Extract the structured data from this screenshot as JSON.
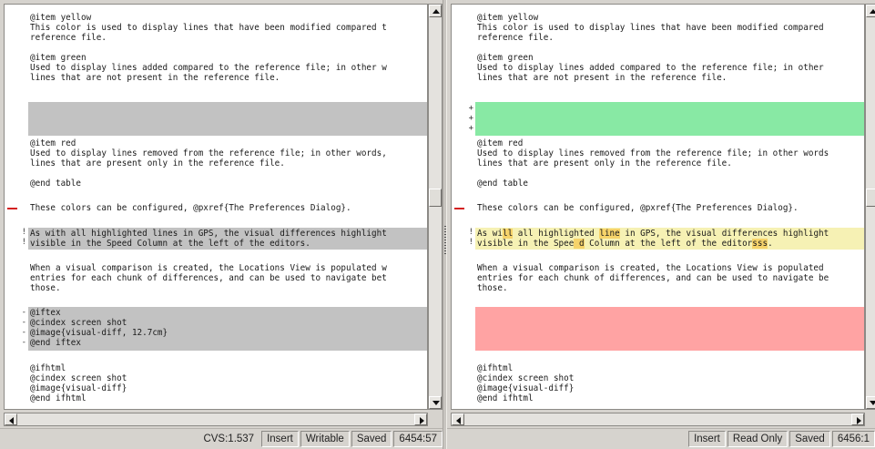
{
  "colors": {
    "removed_gray": "#c2c2c2",
    "added_green": "#88e9a4",
    "removed_red": "#ffa3a3",
    "changed_yellow": "#f6f1b4",
    "changed_word": "#f6d36a",
    "marker_red": "#d42020"
  },
  "left_editor": {
    "lines": {
      "l1": "@item yellow",
      "l2": "This color is used to display lines that have been modified compared t",
      "l3": "reference file.",
      "l5": "@item green",
      "l6": "Used to display lines added compared to the reference file; in other w",
      "l7": "lines that are not present in the reference file.",
      "l13": "@item red",
      "l14": "Used to display lines removed from the reference file; in other words,",
      "l15": "lines that are present only in the reference file.",
      "l17": "@end table",
      "l19": "These colors can be configured, @pxref{The Preferences Dialog}.",
      "l21": "As with all highlighted lines in GPS, the visual differences highlight",
      "l22": "visible in the Speed Column at the left of the editors.",
      "l24": "When a visual comparison is created, the Locations View is populated w",
      "l25": "entries for each chunk of differences, and can be used to navigate bet",
      "l26": "those.",
      "l28": "@iftex",
      "l29": "@cindex screen shot",
      "l30": "@image{visual-diff, 12.7cm}",
      "l31": "@end iftex",
      "l33": "@ifhtml",
      "l34": "@cindex screen shot",
      "l35": "@image{visual-diff}",
      "l36": "@end ifhtml"
    },
    "marks": {
      "changed": "!",
      "removed": "-"
    },
    "status": {
      "cvs": "CVS:1.537",
      "mode": "Insert",
      "access": "Writable",
      "state": "Saved",
      "position": "6454:57"
    }
  },
  "right_editor": {
    "lines": {
      "l1": "@item yellow",
      "l2": "This color is used to display lines that have been modified compared ",
      "l3": "reference file.",
      "l5": "@item green",
      "l6": "Used to display lines added compared to the reference file; in other ",
      "l7": "lines that are not present in the reference file.",
      "l13": "@item red",
      "l14": "Used to display lines removed from the reference file; in other words",
      "l15": "lines that are present only in the reference file.",
      "l17": "@end table",
      "l19": "These colors can be configured, @pxref{The Preferences Dialog}.",
      "l21a": "As wi",
      "l21b": "ll",
      "l21c": " all highlighted ",
      "l21d": "line",
      "l21e": " in GPS, the visual differences highlight",
      "l22a": "visible in the Spee",
      "l22b": " d",
      "l22c": " Column at the left of the editor",
      "l22d": "sss",
      "l22e": ".",
      "l24": "When a visual comparison is created, the Locations View is populated ",
      "l25": "entries for each chunk of differences, and can be used to navigate be",
      "l26": "those.",
      "l33": "@ifhtml",
      "l34": "@cindex screen shot",
      "l35": "@image{visual-diff}",
      "l36": "@end ifhtml"
    },
    "marks": {
      "changed": "!",
      "added": "+"
    },
    "status": {
      "mode": "Insert",
      "access": "Read Only",
      "state": "Saved",
      "position": "6456:1"
    }
  }
}
